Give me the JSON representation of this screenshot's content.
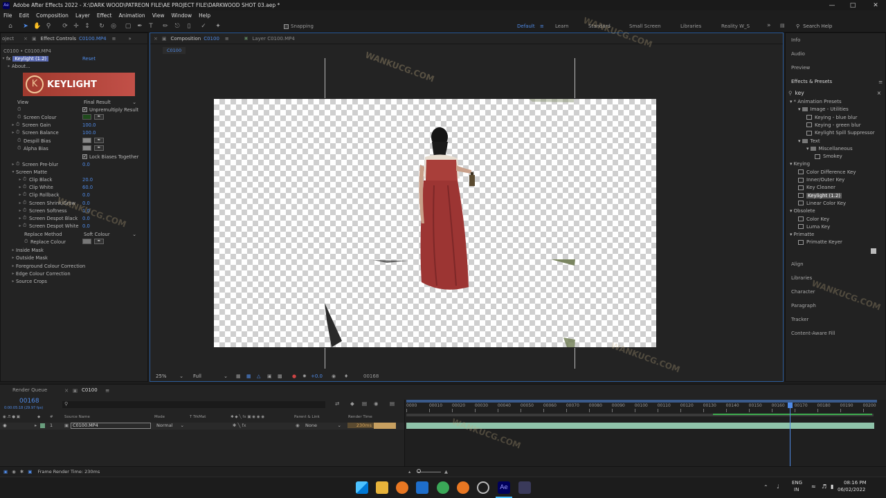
{
  "window": {
    "title": "Adobe After Effects 2022 - X:\\DARK WOOD\\PATREON FILE\\AE PROJECT FILE\\DARKWOOD SHOT 03.aep *"
  },
  "menu": [
    "File",
    "Edit",
    "Composition",
    "Layer",
    "Effect",
    "Animation",
    "View",
    "Window",
    "Help"
  ],
  "toolbar": {
    "snapping": "Snapping",
    "workspaces": [
      "Default",
      "Learn",
      "Standard",
      "Small Screen",
      "Libraries",
      "Reality W_S"
    ],
    "search_placeholder": "Search Help"
  },
  "effect_controls": {
    "tab_project": "oject",
    "tab_label": "Effect Controls",
    "tab_file": "C0100.MP4",
    "breadcrumb": "C0100 • C0100.MP4",
    "effect_name": "Keylight (1.2)",
    "reset": "Reset",
    "about": "About...",
    "logo_text": "KEYLIGHT",
    "view_label": "View",
    "view_value": "Final Result",
    "unpremultiply": "Unpremultiply Result",
    "screen_colour": "Screen Colour",
    "screen_gain": "Screen Gain",
    "screen_gain_value": "100.0",
    "screen_balance": "Screen Balance",
    "screen_balance_value": "100.0",
    "despill_bias": "Despill Bias",
    "alpha_bias": "Alpha Bias",
    "lock_biases": "Lock Biases Together",
    "screen_preblur": "Screen Pre-blur",
    "screen_preblur_value": "0.0",
    "screen_matte": "Screen Matte",
    "clip_black": "Clip Black",
    "clip_black_value": "20.0",
    "clip_white": "Clip White",
    "clip_white_value": "60.0",
    "clip_rollback": "Clip Rollback",
    "clip_rollback_value": "0.0",
    "shrink_grow": "Screen Shrink/Grow",
    "shrink_grow_value": "0.0",
    "softness": "Screen Softness",
    "softness_value": "1.0",
    "despot_black": "Screen Despot Black",
    "despot_black_value": "0.0",
    "despot_white": "Screen Despot White",
    "despot_white_value": "0.0",
    "replace_method": "Replace Method",
    "replace_method_value": "Soft Colour",
    "replace_colour": "Replace Colour",
    "inside_mask": "Inside Mask",
    "outside_mask": "Outside Mask",
    "foreground_cc": "Foreground Colour Correction",
    "edge_cc": "Edge Colour Correction",
    "source_crops": "Source Crops",
    "screen_colour_hex": "#1f4a1c"
  },
  "composition": {
    "tab_label": "Composition",
    "tab_name": "C0100",
    "layer_tab": "Layer C0100.MP4",
    "sub_tab": "C0100",
    "zoom": "25%",
    "resolution": "Full",
    "exposure": "+0.0",
    "timecode": "00168"
  },
  "right_panel": {
    "items_top": [
      "Info",
      "Audio",
      "Preview"
    ],
    "effects_title": "Effects & Presets",
    "search_value": "key",
    "tree": [
      {
        "t": "* Animation Presets",
        "lvl": 0,
        "k": "cat"
      },
      {
        "t": "Image - Utilities",
        "lvl": 1,
        "k": "folder"
      },
      {
        "t": "Keying - blue blur",
        "lvl": 2,
        "k": "fx"
      },
      {
        "t": "Keying - green blur",
        "lvl": 2,
        "k": "fx"
      },
      {
        "t": "Keylight Spill Suppressor",
        "lvl": 2,
        "k": "fx"
      },
      {
        "t": "Text",
        "lvl": 1,
        "k": "folder"
      },
      {
        "t": "Miscellaneous",
        "lvl": 2,
        "k": "folder"
      },
      {
        "t": "Smokey",
        "lvl": 3,
        "k": "fx"
      },
      {
        "t": "Keying",
        "lvl": 0,
        "k": "cat"
      },
      {
        "t": "Color Difference Key",
        "lvl": 1,
        "k": "fx"
      },
      {
        "t": "Inner/Outer Key",
        "lvl": 1,
        "k": "fx"
      },
      {
        "t": "Key Cleaner",
        "lvl": 1,
        "k": "fx"
      },
      {
        "t": "Keylight (1.2)",
        "lvl": 1,
        "k": "fx-sel"
      },
      {
        "t": "Linear Color Key",
        "lvl": 1,
        "k": "fx"
      },
      {
        "t": "Obsolete",
        "lvl": 0,
        "k": "cat"
      },
      {
        "t": "Color Key",
        "lvl": 1,
        "k": "fx"
      },
      {
        "t": "Luma Key",
        "lvl": 1,
        "k": "fx"
      },
      {
        "t": "Primatte",
        "lvl": 0,
        "k": "cat"
      },
      {
        "t": "Primatte Keyer",
        "lvl": 1,
        "k": "fx"
      }
    ],
    "items_bottom": [
      "Align",
      "Libraries",
      "Character",
      "Paragraph",
      "Tracker",
      "Content-Aware Fill"
    ]
  },
  "timeline": {
    "render_queue": "Render Queue",
    "comp_tab": "C0100",
    "timecode": "00168",
    "timecode_sub": "0:00:05:18 (29.97 fps)",
    "col_source": "Source Name",
    "col_mode": "Mode",
    "col_trkmat": "T  TrkMat",
    "col_parent": "Parent & Link",
    "col_render": "Render Time",
    "layer_num": "1",
    "layer_name": "C0100.MP4",
    "layer_mode": "Normal",
    "layer_parent": "None",
    "layer_render": "230ms",
    "ruler": [
      "0000",
      "00010",
      "00020",
      "00030",
      "00040",
      "00050",
      "00060",
      "00070",
      "00080",
      "00090",
      "00100",
      "00110",
      "00120",
      "00130",
      "00140",
      "00150",
      "00160",
      "00170",
      "00180",
      "00190",
      "00200"
    ],
    "playhead_frame": 168,
    "frame_max": 205,
    "status": "Frame Render Time:  230ms"
  },
  "taskbar": {
    "lang": "ENG",
    "region": "IN",
    "time": "08:16 PM",
    "date": "06/02/2022"
  },
  "watermark": "WANKUCG.COM"
}
